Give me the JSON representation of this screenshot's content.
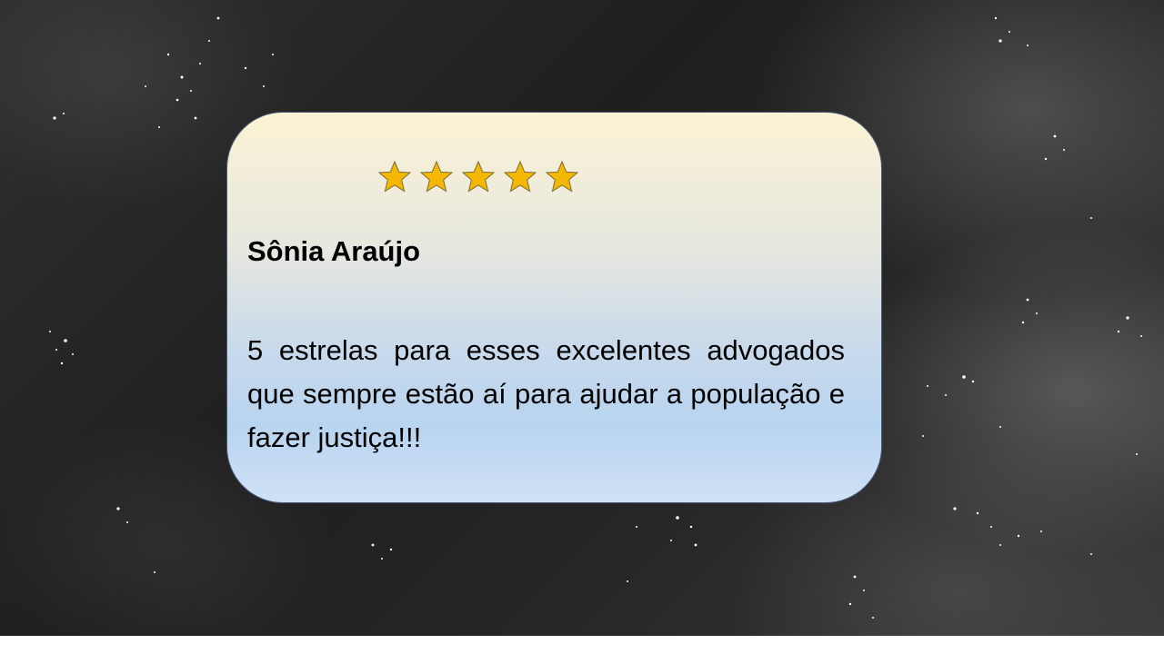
{
  "testimonial": {
    "rating": 5,
    "rating_max": 5,
    "star_color": "#f5b800",
    "name": "Sônia Araújo",
    "review": "5 estrelas para esses excelentes advogados que sempre estão aí para ajudar a população e fazer justiça!!!"
  },
  "background": {
    "style": "night-sky-clouds",
    "base_color": "#262626"
  }
}
